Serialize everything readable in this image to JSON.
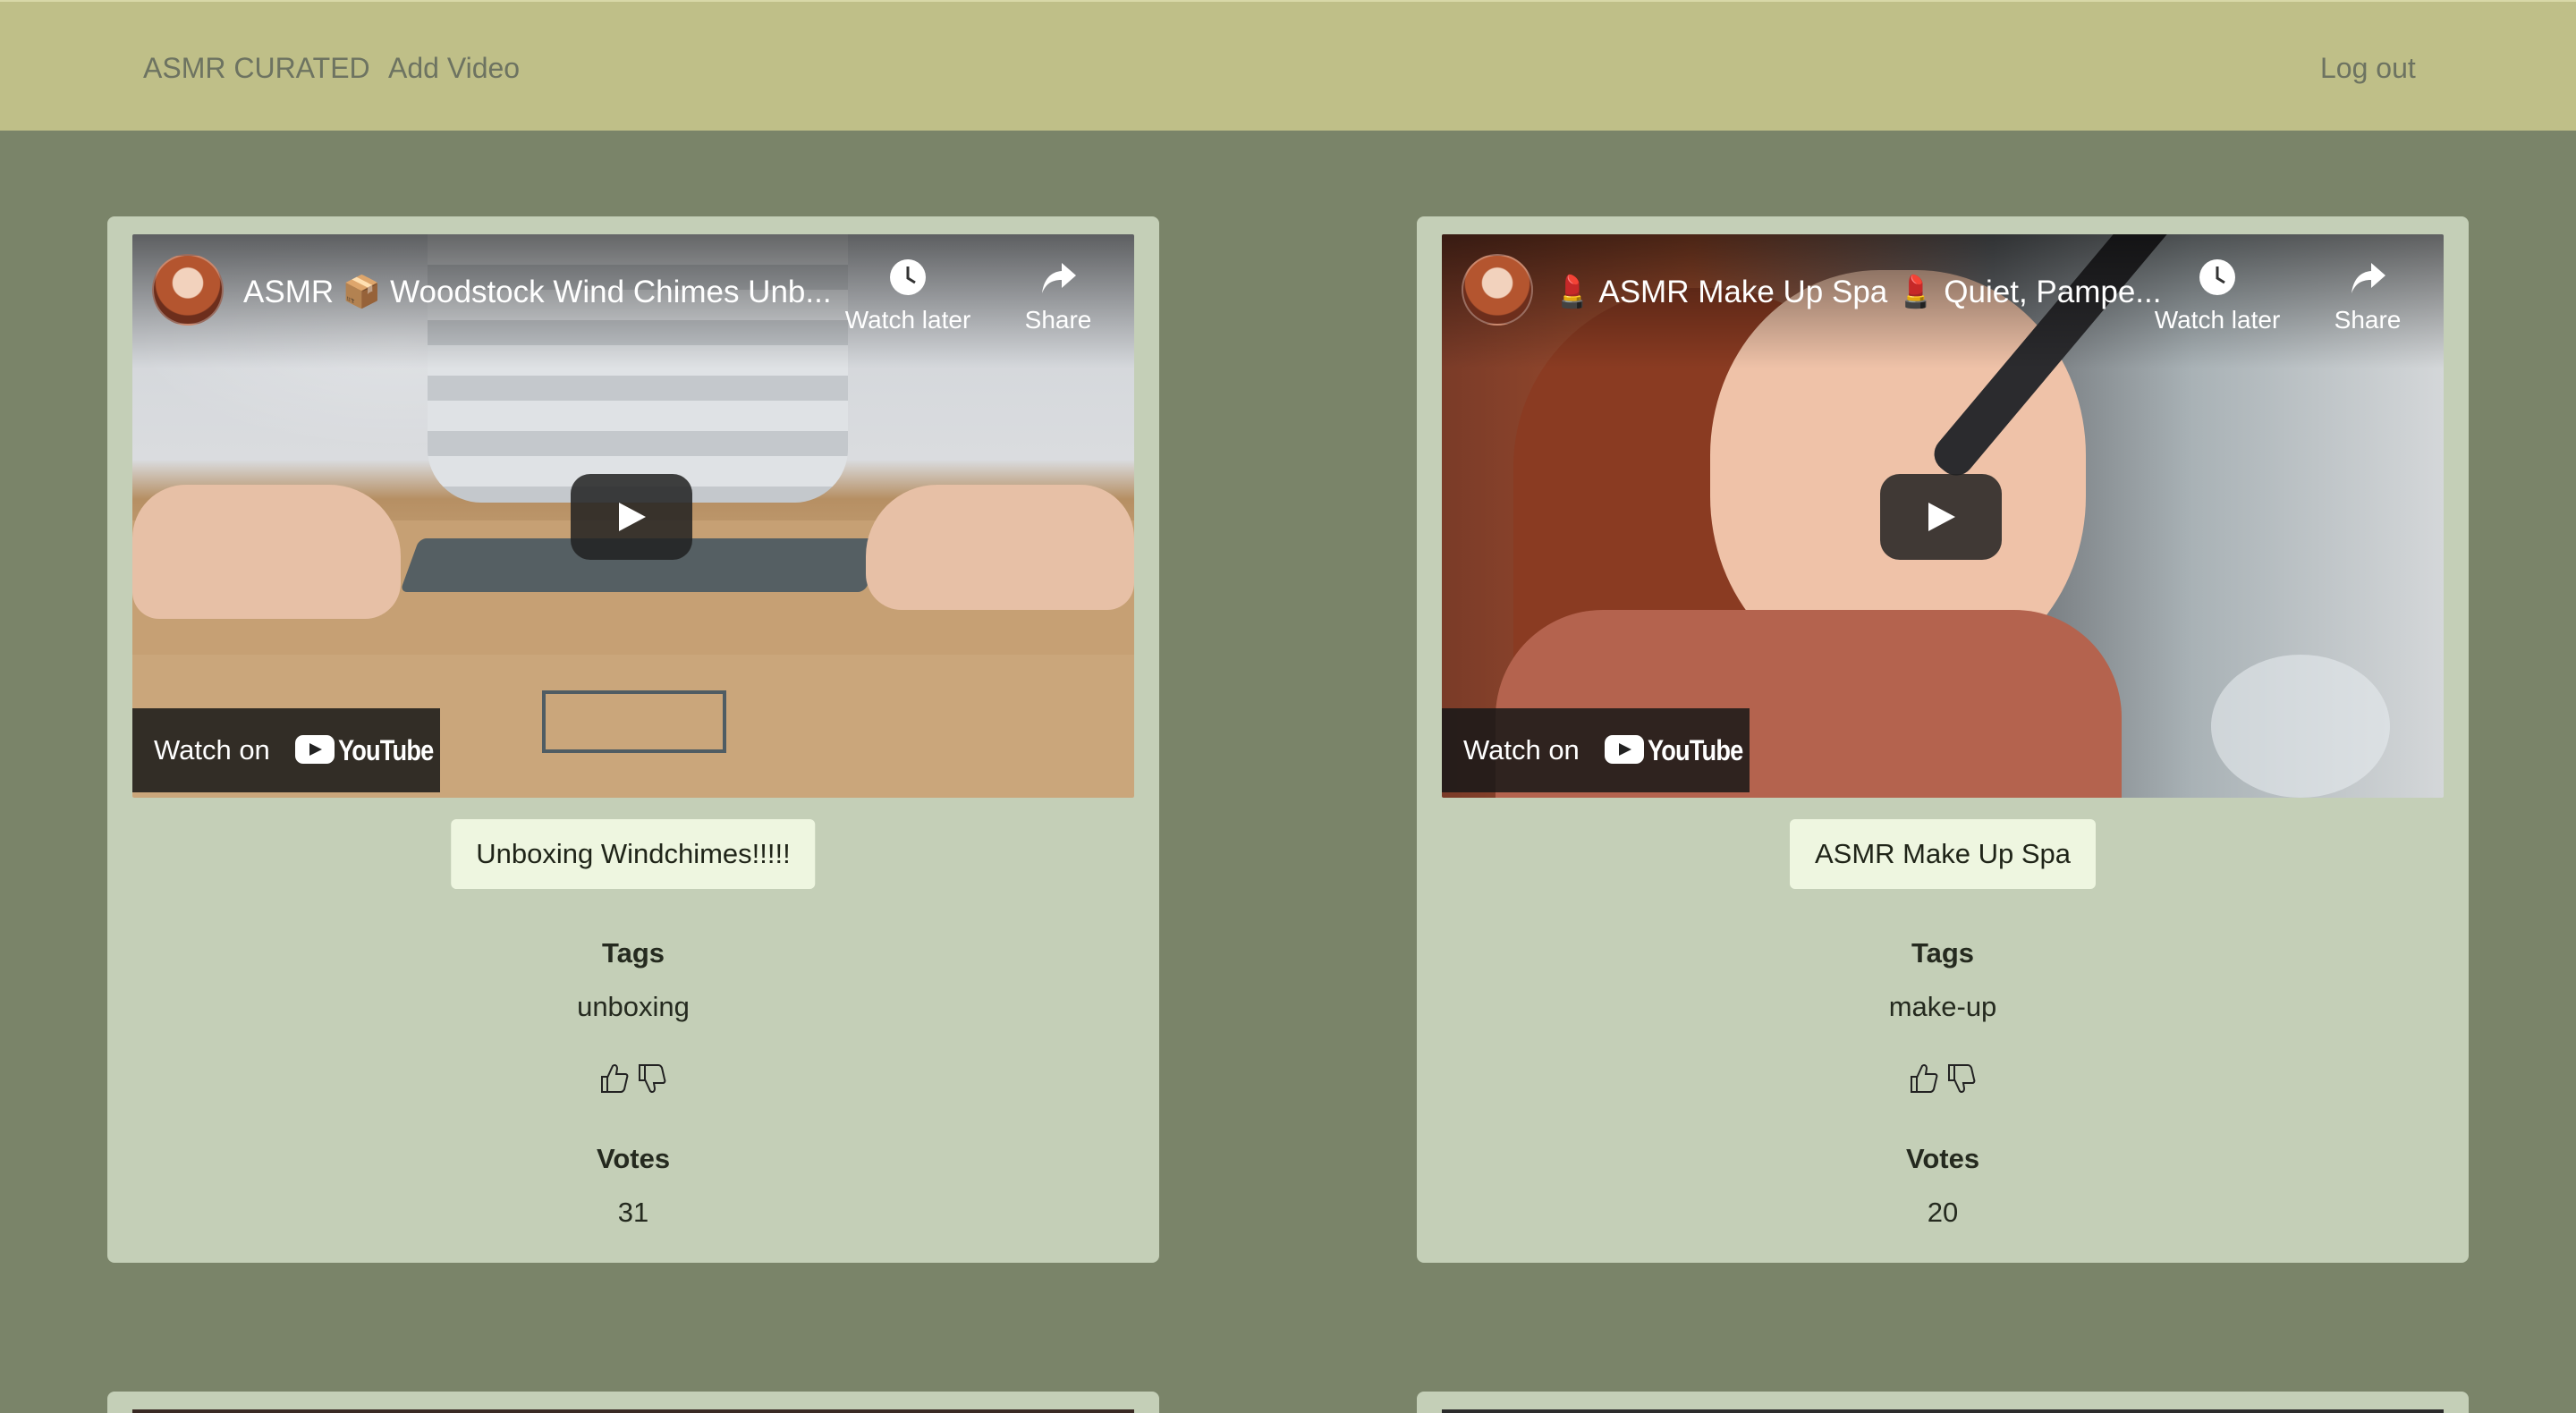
{
  "nav": {
    "brand": "ASMR CURATED",
    "add_video": "Add Video",
    "logout": "Log out"
  },
  "labels": {
    "tags": "Tags",
    "votes": "Votes"
  },
  "player": {
    "watch_later": "Watch later",
    "share": "Share",
    "watch_on": "Watch on",
    "youtube": "YouTube"
  },
  "videos": [
    {
      "embed_title": "ASMR 📦 Woodstock Wind Chimes Unb...",
      "title": "Unboxing Windchimes!!!!!",
      "tag": "unboxing",
      "votes": "31"
    },
    {
      "embed_title": "💄 ASMR Make Up Spa 💄 Quiet, Pampe...",
      "title": "ASMR Make Up Spa",
      "tag": "make-up",
      "votes": "20"
    }
  ],
  "colors": {
    "background": "#7a8469",
    "navbar": "#bfbf88",
    "card": "#c4cfb7",
    "title_button": "#eef6e0"
  }
}
